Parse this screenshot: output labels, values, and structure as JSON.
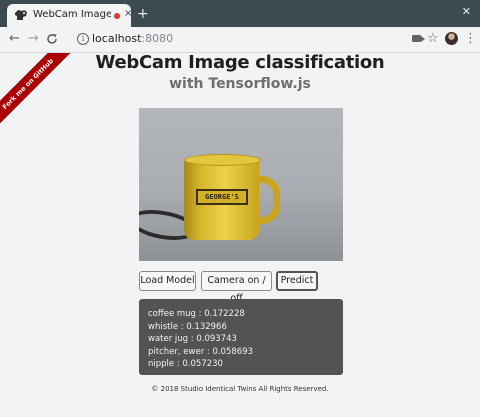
{
  "browser": {
    "tab": {
      "title": "WebCam Image classi",
      "favicon": "dog-favicon",
      "recording_indicator": "recording-dot-icon"
    },
    "new_tab_symbol": "+",
    "close_tab_symbol": "×",
    "window_close_symbol": "✕",
    "nav": {
      "back": "←",
      "forward": "→",
      "reload": "C"
    },
    "address": {
      "host": "localhost",
      "port": ":8080",
      "info_symbol": "i"
    },
    "toolbar_icons": {
      "star": "☆",
      "menu": "⋮"
    }
  },
  "page": {
    "ribbon": "Fork me on GitHub",
    "title": "WebCam Image classification",
    "subtitle": "with Tensorflow.js",
    "video": {
      "mug_label": "GEORGE'S"
    },
    "buttons": {
      "load_model": "Load Model",
      "camera_toggle": "Camera on / off",
      "predict": "Predict"
    },
    "predictions": [
      "coffee mug : 0.172228",
      "whistle : 0.132966",
      "water jug : 0.093743",
      "pitcher, ewer : 0.058693",
      "nipple : 0.057230"
    ],
    "footer": "© 2018 Studio Identical Twins All Rights Reserved."
  },
  "colors": {
    "ribbon": "#aa0000",
    "results_bg": "#535353",
    "tabstrip_bg": "#3c4a51",
    "recording_dot": "#e0362c"
  }
}
